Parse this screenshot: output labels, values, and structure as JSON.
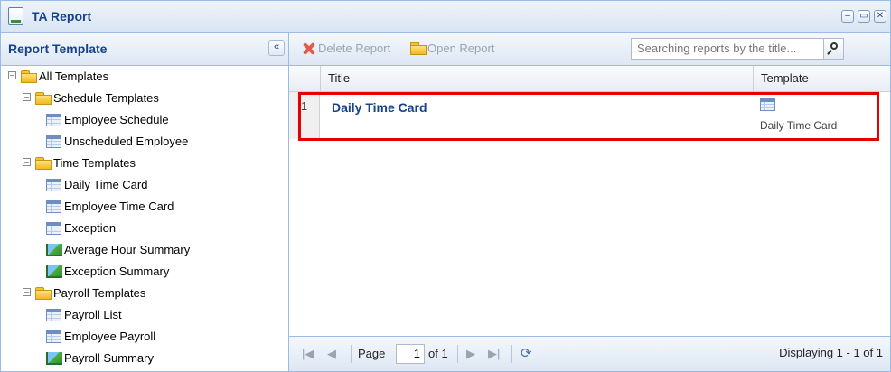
{
  "window": {
    "title": "TA Report",
    "controls": [
      "–",
      "▭",
      "✕"
    ]
  },
  "left_panel": {
    "title": "Report Template",
    "collapse_glyph": "«",
    "tree": [
      {
        "label": "All Templates",
        "type": "folder",
        "toggle": "–"
      },
      {
        "label": "Schedule Templates",
        "type": "folder",
        "toggle": "–"
      },
      {
        "label": "Employee Schedule",
        "type": "grid"
      },
      {
        "label": "Unscheduled Employee",
        "type": "grid"
      },
      {
        "label": "Time Templates",
        "type": "folder",
        "toggle": "–"
      },
      {
        "label": "Daily Time Card",
        "type": "grid"
      },
      {
        "label": "Employee Time Card",
        "type": "grid"
      },
      {
        "label": "Exception",
        "type": "grid"
      },
      {
        "label": "Average Hour Summary",
        "type": "chart"
      },
      {
        "label": "Exception Summary",
        "type": "chart"
      },
      {
        "label": "Payroll Templates",
        "type": "folder",
        "toggle": "–"
      },
      {
        "label": "Payroll List",
        "type": "grid"
      },
      {
        "label": "Employee Payroll",
        "type": "grid"
      },
      {
        "label": "Payroll Summary",
        "type": "chart"
      }
    ]
  },
  "toolbar": {
    "delete_label": "Delete Report",
    "open_label": "Open Report",
    "search_placeholder": "Searching reports by the title..."
  },
  "grid": {
    "columns": [
      "Title",
      "Template"
    ],
    "rows": [
      {
        "num": "1",
        "title": "Daily Time Card",
        "template": "Daily Time Card"
      }
    ]
  },
  "pager": {
    "page_label": "Page",
    "page_value": "1",
    "of_label": "of 1",
    "display_text": "Displaying 1 - 1 of 1"
  },
  "colors": {
    "accent": "#15428b",
    "highlight": "#e60000"
  }
}
